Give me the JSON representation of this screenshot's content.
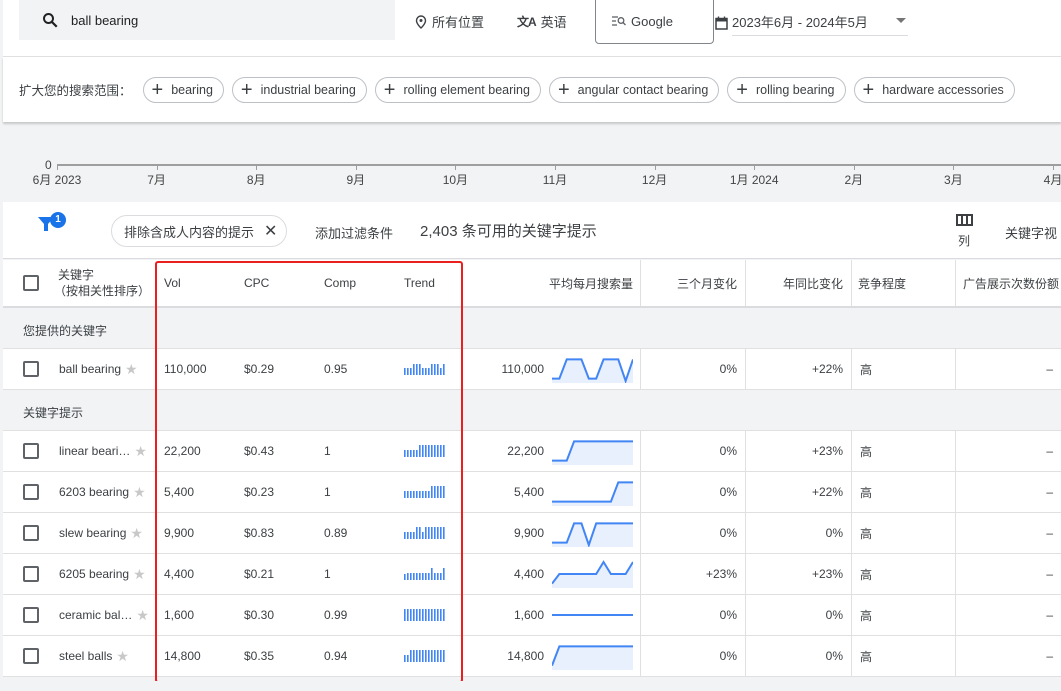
{
  "search": {
    "query": "ball bearing",
    "icon": "search-icon"
  },
  "top_filters": {
    "location": {
      "icon": "location-pin-icon",
      "label": "所有位置"
    },
    "language": {
      "icon": "translate-icon",
      "label": "英语"
    },
    "network": {
      "icon": "search-network-icon",
      "label": "Google"
    },
    "date_range": {
      "icon": "calendar-icon",
      "label": "2023年6月 - 2024年5月"
    }
  },
  "broaden": {
    "label": "扩大您的搜索范围：",
    "chips": [
      "bearing",
      "industrial bearing",
      "rolling element bearing",
      "angular contact bearing",
      "rolling bearing",
      "hardware accessories"
    ]
  },
  "timeline": {
    "y_zero_label": "0",
    "months": [
      "6月 2023",
      "7月",
      "8月",
      "9月",
      "10月",
      "11月",
      "12月",
      "1月 2024",
      "2月",
      "3月",
      "4月"
    ]
  },
  "toolbar": {
    "filter_count": "1",
    "exclude_chip": "排除含成人内容的提示",
    "add_filter": "添加过滤条件",
    "result_count": "2,403 条可用的关键字提示",
    "columns_label": "列",
    "keyword_view": "关键字视"
  },
  "table": {
    "headers": {
      "keyword": "关键字",
      "keyword_sub": "（按相关性排序）",
      "vol": "Vol",
      "cpc": "CPC",
      "comp": "Comp",
      "trend": "Trend",
      "avg_monthly": "平均每月搜索量",
      "three_month": "三个月变化",
      "yoy": "年同比变化",
      "competition": "竞争程度",
      "impression_share": "广告展示次数份额"
    },
    "group_provided": "您提供的关键字",
    "group_ideas": "关键字提示",
    "provided": [
      {
        "keyword": "ball bearing",
        "vol": "110,000",
        "cpc": "$0.29",
        "comp": "0.95",
        "avg": "110,000",
        "three_month": "0%",
        "yoy": "+22%",
        "competition": "高",
        "share": "–",
        "mini": [
          0.6,
          0.6,
          0.6,
          0.9,
          0.9,
          0.9,
          0.6,
          0.6,
          0.6,
          0.9,
          0.9,
          0.9,
          0.6,
          0.9
        ],
        "spark": [
          0.1,
          0.1,
          0.9,
          0.9,
          0.9,
          0.1,
          0.1,
          0.9,
          0.9,
          0.9,
          0.0,
          0.9
        ]
      }
    ],
    "ideas": [
      {
        "keyword": "linear beari…",
        "vol": "22,200",
        "cpc": "$0.43",
        "comp": "1",
        "avg": "22,200",
        "three_month": "0%",
        "yoy": "+23%",
        "competition": "高",
        "share": "–",
        "mini": [
          0.6,
          0.6,
          0.6,
          0.6,
          0.6,
          1,
          1,
          1,
          1,
          1,
          1,
          1,
          1,
          1
        ],
        "spark": [
          0.1,
          0.1,
          0.1,
          0.9,
          0.9,
          0.9,
          0.9,
          0.9,
          0.9,
          0.9,
          0.9,
          0.9
        ]
      },
      {
        "keyword": "6203 bearing",
        "vol": "5,400",
        "cpc": "$0.23",
        "comp": "1",
        "avg": "5,400",
        "three_month": "0%",
        "yoy": "+22%",
        "competition": "高",
        "share": "–",
        "mini": [
          0.6,
          0.6,
          0.6,
          0.6,
          0.6,
          0.6,
          0.6,
          0.6,
          0.6,
          1,
          1,
          1,
          1,
          1
        ],
        "spark": [
          0.1,
          0.1,
          0.1,
          0.1,
          0.1,
          0.1,
          0.1,
          0.1,
          0.1,
          0.9,
          0.9,
          0.9
        ]
      },
      {
        "keyword": "slew bearing",
        "vol": "9,900",
        "cpc": "$0.83",
        "comp": "0.89",
        "avg": "9,900",
        "three_month": "0%",
        "yoy": "0%",
        "competition": "高",
        "share": "–",
        "mini": [
          0.6,
          0.6,
          0.6,
          0.6,
          1,
          1,
          0.6,
          1,
          1,
          1,
          1,
          1,
          1,
          1
        ],
        "spark": [
          0.1,
          0.1,
          0.1,
          0.9,
          0.9,
          0.0,
          0.9,
          0.9,
          0.9,
          0.9,
          0.9,
          0.9
        ]
      },
      {
        "keyword": "6205 bearing",
        "vol": "4,400",
        "cpc": "$0.21",
        "comp": "1",
        "avg": "4,400",
        "three_month": "+23%",
        "yoy": "+23%",
        "competition": "高",
        "share": "–",
        "mini": [
          0.5,
          0.6,
          0.6,
          0.6,
          0.6,
          0.6,
          0.6,
          0.6,
          0.6,
          1,
          0.6,
          0.6,
          0.6,
          1
        ],
        "spark": [
          0.1,
          0.5,
          0.5,
          0.5,
          0.5,
          0.5,
          0.5,
          1.0,
          0.5,
          0.5,
          0.5,
          1.0
        ]
      },
      {
        "keyword": "ceramic bal…",
        "vol": "1,600",
        "cpc": "$0.30",
        "comp": "0.99",
        "avg": "1,600",
        "three_month": "0%",
        "yoy": "0%",
        "competition": "高",
        "share": "–",
        "mini": [
          1,
          1,
          1,
          1,
          1,
          1,
          1,
          1,
          1,
          1,
          1,
          1,
          1,
          1
        ],
        "spark": [
          0.5,
          0.5,
          0.5,
          0.5,
          0.5,
          0.5,
          0.5,
          0.5,
          0.5,
          0.5,
          0.5,
          0.5
        ]
      },
      {
        "keyword": "steel balls",
        "vol": "14,800",
        "cpc": "$0.35",
        "comp": "0.94",
        "avg": "14,800",
        "three_month": "0%",
        "yoy": "0%",
        "competition": "高",
        "share": "–",
        "mini": [
          0.6,
          0.6,
          1,
          1,
          1,
          1,
          1,
          1,
          1,
          1,
          1,
          1,
          1,
          1
        ],
        "spark": [
          0.1,
          0.9,
          0.9,
          0.9,
          0.9,
          0.9,
          0.9,
          0.9,
          0.9,
          0.9,
          0.9,
          0.9
        ]
      }
    ]
  },
  "colors": {
    "accent": "#1a73e8",
    "spark_line": "#4285f4",
    "spark_fill": "#e8f0fe",
    "highlight_box": "#ea1f1f"
  }
}
